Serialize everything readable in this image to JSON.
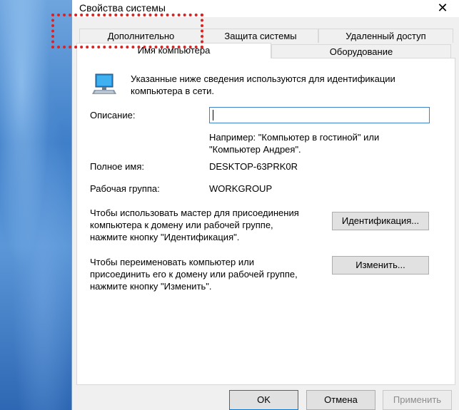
{
  "window": {
    "title": "Свойства системы"
  },
  "tabs": {
    "row1": [
      "Дополнительно",
      "Защита системы",
      "Удаленный доступ"
    ],
    "row2": [
      "Имя компьютера",
      "Оборудование"
    ],
    "active": "Имя компьютера"
  },
  "panel": {
    "intro": "Указанные ниже сведения используются для идентификации\nкомпьютера в сети.",
    "description_label": "Описание:",
    "description_value": "",
    "example": "Например: \"Компьютер в гостиной\" или\n\"Компьютер Андрея\".",
    "fullname_label": "Полное имя:",
    "fullname_value": "DESKTOP-63PRK0R",
    "workgroup_label": "Рабочая группа:",
    "workgroup_value": "WORKGROUP",
    "id_text": "Чтобы использовать мастер для присоединения\nкомпьютера к домену или рабочей группе,\nнажмите кнопку \"Идентификация\".",
    "id_button": "Идентификация...",
    "rename_text": "Чтобы переименовать компьютер или\nприсоединить его к домену или рабочей группе,\nнажмите кнопку \"Изменить\".",
    "rename_button": "Изменить..."
  },
  "footer": {
    "ok": "OK",
    "cancel": "Отмена",
    "apply": "Применить"
  },
  "icons": {
    "close": "close-icon",
    "computer": "computer-icon"
  },
  "colors": {
    "accent": "#0078d7",
    "highlight": "#e02020"
  }
}
